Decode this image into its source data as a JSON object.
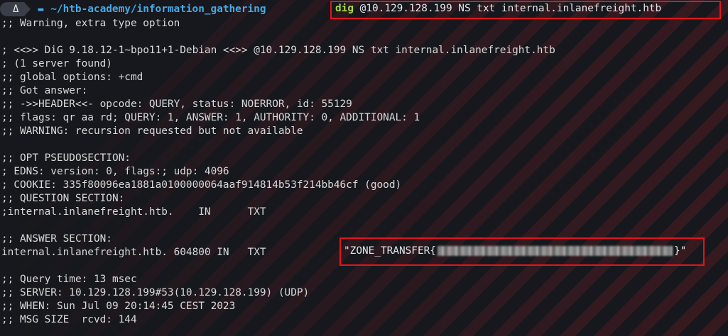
{
  "prompt": {
    "user_glyph": "Δ",
    "directory": "~/htb-academy/information_gathering",
    "command_keyword": "dig",
    "command_args": " @10.129.128.199 NS txt internal.inlanefreight.htb"
  },
  "output": {
    "warning_extra": ";; Warning, extra type option",
    "banner": "; <<>> DiG 9.18.12-1~bpo11+1-Debian <<>> @10.129.128.199 NS txt internal.inlanefreight.htb",
    "server_found": "; (1 server found)",
    "global_options": ";; global options: +cmd",
    "got_answer": ";; Got answer:",
    "header": ";; ->>HEADER<<- opcode: QUERY, status: NOERROR, id: 55129",
    "flags": ";; flags: qr aa rd; QUERY: 1, ANSWER: 1, AUTHORITY: 0, ADDITIONAL: 1",
    "recursion_warning": ";; WARNING: recursion requested but not available",
    "opt_pseudosection": ";; OPT PSEUDOSECTION:",
    "edns": "; EDNS: version: 0, flags:; udp: 4096",
    "cookie": "; COOKIE: 335f80096ea1881a0100000064aaf914814b53f214bb46cf (good)",
    "question_section": ";; QUESTION SECTION:",
    "question_record": ";internal.inlanefreight.htb.    IN      TXT",
    "answer_section": ";; ANSWER SECTION:",
    "answer_record": "internal.inlanefreight.htb. 604800 IN   TXT",
    "txt_value_prefix": "\"ZONE_TRANSFER{",
    "txt_value_suffix": "}\"",
    "query_time": ";; Query time: 13 msec",
    "server": ";; SERVER: 10.129.128.199#53(10.129.128.199) (UDP)",
    "when": ";; WHEN: Sun Jul 09 20:14:45 CEST 2023",
    "msg_size": ";; MSG SIZE  rcvd: 144"
  },
  "colors": {
    "background": "#16181d",
    "highlight_box": "#e0151b",
    "directory": "#48a9e6",
    "command_keyword": "#a8d84a"
  }
}
